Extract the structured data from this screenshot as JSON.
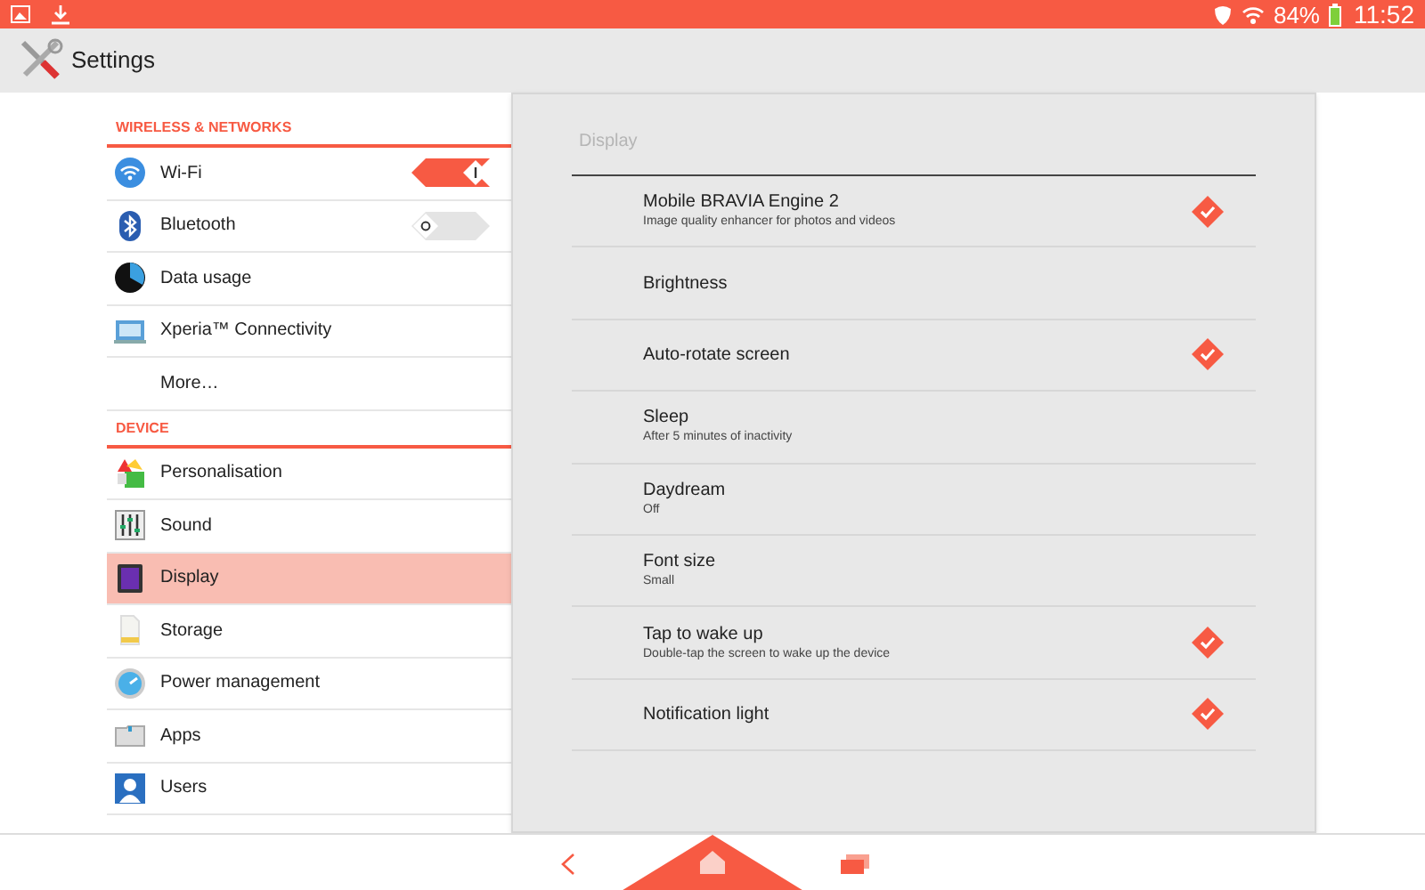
{
  "status_bar": {
    "battery": "84%",
    "time": "11:52"
  },
  "action_bar": {
    "title": "Settings"
  },
  "sidebar": {
    "sections": [
      {
        "header": "WIRELESS & NETWORKS",
        "items": [
          {
            "label": "Wi-Fi",
            "kind": "switch",
            "on": true,
            "selected": false
          },
          {
            "label": "Bluetooth",
            "kind": "switch",
            "on": false,
            "selected": false
          },
          {
            "label": "Data usage",
            "kind": "plain",
            "selected": false
          },
          {
            "label": "Xperia™ Connectivity",
            "kind": "plain",
            "selected": false
          },
          {
            "label": "More…",
            "kind": "plain",
            "selected": false
          }
        ]
      },
      {
        "header": "DEVICE",
        "items": [
          {
            "label": "Personalisation",
            "kind": "plain",
            "selected": false
          },
          {
            "label": "Sound",
            "kind": "plain",
            "selected": false
          },
          {
            "label": "Display",
            "kind": "plain",
            "selected": true
          },
          {
            "label": "Storage",
            "kind": "plain",
            "selected": false
          },
          {
            "label": "Power management",
            "kind": "plain",
            "selected": false
          },
          {
            "label": "Apps",
            "kind": "plain",
            "selected": false
          },
          {
            "label": "Users",
            "kind": "plain",
            "selected": false
          }
        ]
      }
    ]
  },
  "panel": {
    "title": "Display",
    "rows": [
      {
        "title": "Mobile BRAVIA Engine 2",
        "summary": "Image quality enhancer for photos and videos",
        "kind": "checkbox",
        "checked": true
      },
      {
        "title": "Brightness",
        "kind": "plain"
      },
      {
        "title": "Auto-rotate screen",
        "kind": "checkbox",
        "checked": true
      },
      {
        "title": "Sleep",
        "summary": "After 5 minutes of inactivity",
        "kind": "plain"
      },
      {
        "title": "Daydream",
        "summary": "Off",
        "kind": "plain"
      },
      {
        "title": "Font size",
        "summary": "Small",
        "kind": "plain"
      },
      {
        "title": "Tap to wake up",
        "summary": "Double-tap the screen to wake up the device",
        "kind": "checkbox",
        "checked": true
      },
      {
        "title": "Notification light",
        "kind": "checkbox",
        "checked": true
      }
    ]
  }
}
